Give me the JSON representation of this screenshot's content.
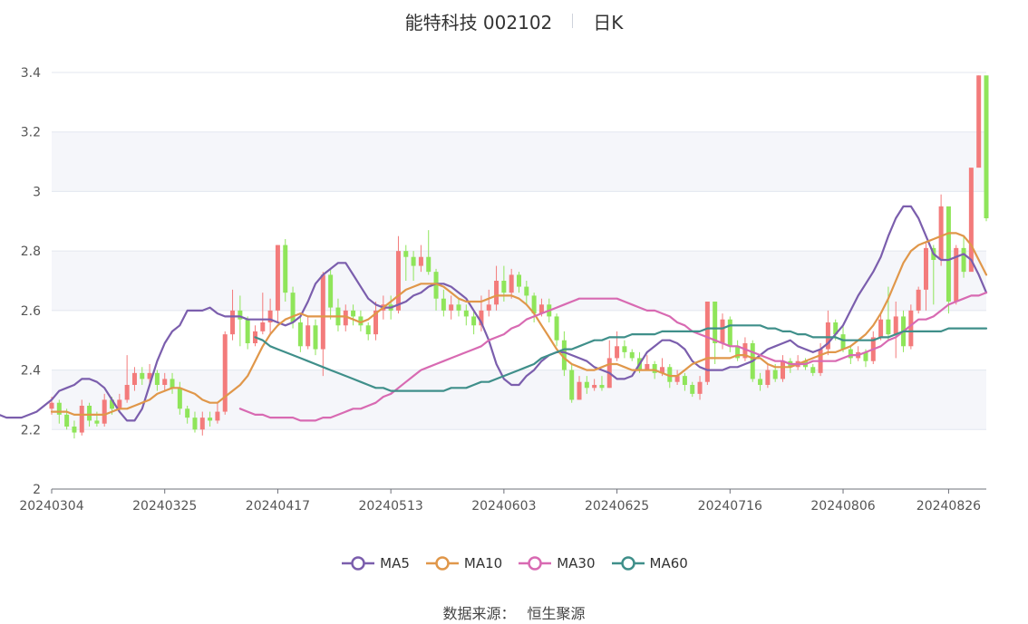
{
  "header": {
    "title": "能特科技 002102",
    "period": "日K"
  },
  "source": {
    "label": "数据来源：",
    "value": "恒生聚源"
  },
  "colors": {
    "up": "#f37b7b",
    "down": "#8fe55a",
    "grid": "#e3e7ef",
    "band": "#f5f6fa",
    "MA5": "#7b5ead",
    "MA10": "#e0974a",
    "MA30": "#d86ab2",
    "MA60": "#3f8f8a"
  },
  "chart_data": {
    "type": "candlestick",
    "ylim": [
      2.0,
      3.4
    ],
    "yticks": [
      "2",
      "2.2",
      "2.4",
      "2.6",
      "2.8",
      "3",
      "3.2",
      "3.4"
    ],
    "xtick_labels": [
      "20240304",
      "20240325",
      "20240417",
      "20240513",
      "20240603",
      "20240625",
      "20240716",
      "20240806",
      "20240826"
    ],
    "xtick_index": [
      0,
      15,
      30,
      45,
      60,
      75,
      90,
      105,
      119
    ],
    "candles": [
      [
        2.27,
        2.29,
        2.31,
        2.25
      ],
      [
        2.29,
        2.25,
        2.3,
        2.22
      ],
      [
        2.25,
        2.21,
        2.27,
        2.2
      ],
      [
        2.21,
        2.19,
        2.23,
        2.17
      ],
      [
        2.19,
        2.28,
        2.3,
        2.18
      ],
      [
        2.28,
        2.23,
        2.29,
        2.21
      ],
      [
        2.23,
        2.22,
        2.26,
        2.21
      ],
      [
        2.22,
        2.3,
        2.32,
        2.21
      ],
      [
        2.3,
        2.27,
        2.31,
        2.25
      ],
      [
        2.27,
        2.3,
        2.32,
        2.26
      ],
      [
        2.3,
        2.35,
        2.45,
        2.29
      ],
      [
        2.35,
        2.39,
        2.41,
        2.33
      ],
      [
        2.39,
        2.37,
        2.41,
        2.35
      ],
      [
        2.37,
        2.39,
        2.42,
        2.35
      ],
      [
        2.39,
        2.35,
        2.4,
        2.33
      ],
      [
        2.35,
        2.37,
        2.39,
        2.33
      ],
      [
        2.37,
        2.34,
        2.39,
        2.32
      ],
      [
        2.34,
        2.27,
        2.36,
        2.25
      ],
      [
        2.27,
        2.24,
        2.28,
        2.22
      ],
      [
        2.24,
        2.2,
        2.26,
        2.19
      ],
      [
        2.2,
        2.24,
        2.26,
        2.18
      ],
      [
        2.24,
        2.23,
        2.26,
        2.21
      ],
      [
        2.23,
        2.26,
        2.29,
        2.22
      ],
      [
        2.26,
        2.52,
        2.53,
        2.25
      ],
      [
        2.52,
        2.6,
        2.67,
        2.5
      ],
      [
        2.6,
        2.57,
        2.65,
        2.48
      ],
      [
        2.57,
        2.49,
        2.58,
        2.47
      ],
      [
        2.49,
        2.53,
        2.55,
        2.48
      ],
      [
        2.53,
        2.56,
        2.66,
        2.52
      ],
      [
        2.56,
        2.6,
        2.64,
        2.52
      ],
      [
        2.6,
        2.82,
        2.82,
        2.56
      ],
      [
        2.82,
        2.66,
        2.84,
        2.63
      ],
      [
        2.66,
        2.56,
        2.68,
        2.54
      ],
      [
        2.56,
        2.48,
        2.58,
        2.46
      ],
      [
        2.48,
        2.55,
        2.58,
        2.47
      ],
      [
        2.55,
        2.47,
        2.57,
        2.45
      ],
      [
        2.47,
        2.72,
        2.73,
        2.38
      ],
      [
        2.72,
        2.61,
        2.74,
        2.57
      ],
      [
        2.61,
        2.55,
        2.64,
        2.53
      ],
      [
        2.55,
        2.6,
        2.62,
        2.53
      ],
      [
        2.6,
        2.58,
        2.62,
        2.55
      ],
      [
        2.58,
        2.55,
        2.6,
        2.53
      ],
      [
        2.55,
        2.52,
        2.56,
        2.5
      ],
      [
        2.52,
        2.6,
        2.63,
        2.5
      ],
      [
        2.6,
        2.62,
        2.65,
        2.57
      ],
      [
        2.62,
        2.6,
        2.65,
        2.57
      ],
      [
        2.6,
        2.8,
        2.85,
        2.59
      ],
      [
        2.8,
        2.78,
        2.82,
        2.7
      ],
      [
        2.78,
        2.75,
        2.8,
        2.7
      ],
      [
        2.75,
        2.78,
        2.82,
        2.73
      ],
      [
        2.78,
        2.73,
        2.87,
        2.72
      ],
      [
        2.73,
        2.64,
        2.74,
        2.6
      ],
      [
        2.64,
        2.6,
        2.67,
        2.58
      ],
      [
        2.6,
        2.62,
        2.65,
        2.57
      ],
      [
        2.62,
        2.6,
        2.64,
        2.58
      ],
      [
        2.6,
        2.58,
        2.62,
        2.55
      ],
      [
        2.58,
        2.55,
        2.6,
        2.52
      ],
      [
        2.55,
        2.6,
        2.65,
        2.53
      ],
      [
        2.6,
        2.62,
        2.67,
        2.58
      ],
      [
        2.62,
        2.7,
        2.75,
        2.6
      ],
      [
        2.7,
        2.66,
        2.75,
        2.63
      ],
      [
        2.66,
        2.72,
        2.74,
        2.64
      ],
      [
        2.72,
        2.68,
        2.73,
        2.66
      ],
      [
        2.68,
        2.65,
        2.7,
        2.62
      ],
      [
        2.65,
        2.59,
        2.66,
        2.56
      ],
      [
        2.59,
        2.62,
        2.64,
        2.58
      ],
      [
        2.62,
        2.58,
        2.64,
        2.56
      ],
      [
        2.58,
        2.5,
        2.59,
        2.48
      ],
      [
        2.5,
        2.4,
        2.53,
        2.38
      ],
      [
        2.4,
        2.3,
        2.42,
        2.29
      ],
      [
        2.3,
        2.36,
        2.38,
        2.3
      ],
      [
        2.36,
        2.34,
        2.38,
        2.32
      ],
      [
        2.34,
        2.35,
        2.37,
        2.33
      ],
      [
        2.35,
        2.34,
        2.38,
        2.33
      ],
      [
        2.34,
        2.44,
        2.5,
        2.34
      ],
      [
        2.44,
        2.48,
        2.53,
        2.43
      ],
      [
        2.48,
        2.46,
        2.5,
        2.44
      ],
      [
        2.46,
        2.44,
        2.47,
        2.43
      ],
      [
        2.44,
        2.4,
        2.46,
        2.39
      ],
      [
        2.4,
        2.42,
        2.45,
        2.4
      ],
      [
        2.42,
        2.39,
        2.43,
        2.37
      ],
      [
        2.39,
        2.41,
        2.44,
        2.38
      ],
      [
        2.41,
        2.36,
        2.42,
        2.34
      ],
      [
        2.36,
        2.38,
        2.4,
        2.35
      ],
      [
        2.38,
        2.35,
        2.39,
        2.33
      ],
      [
        2.35,
        2.32,
        2.36,
        2.31
      ],
      [
        2.32,
        2.36,
        2.38,
        2.3
      ],
      [
        2.36,
        2.63,
        2.63,
        2.35
      ],
      [
        2.63,
        2.49,
        2.63,
        2.42
      ],
      [
        2.49,
        2.57,
        2.59,
        2.47
      ],
      [
        2.57,
        2.48,
        2.58,
        2.46
      ],
      [
        2.48,
        2.44,
        2.5,
        2.43
      ],
      [
        2.44,
        2.49,
        2.51,
        2.43
      ],
      [
        2.49,
        2.37,
        2.5,
        2.36
      ],
      [
        2.37,
        2.35,
        2.39,
        2.33
      ],
      [
        2.35,
        2.4,
        2.42,
        2.34
      ],
      [
        2.4,
        2.37,
        2.42,
        2.36
      ],
      [
        2.37,
        2.43,
        2.45,
        2.36
      ],
      [
        2.43,
        2.41,
        2.44,
        2.39
      ],
      [
        2.41,
        2.43,
        2.45,
        2.4
      ],
      [
        2.43,
        2.41,
        2.44,
        2.4
      ],
      [
        2.41,
        2.39,
        2.42,
        2.38
      ],
      [
        2.39,
        2.47,
        2.49,
        2.38
      ],
      [
        2.47,
        2.56,
        2.6,
        2.45
      ],
      [
        2.56,
        2.52,
        2.57,
        2.5
      ],
      [
        2.52,
        2.47,
        2.55,
        2.46
      ],
      [
        2.47,
        2.44,
        2.48,
        2.42
      ],
      [
        2.44,
        2.46,
        2.48,
        2.43
      ],
      [
        2.46,
        2.43,
        2.47,
        2.41
      ],
      [
        2.43,
        2.51,
        2.53,
        2.42
      ],
      [
        2.51,
        2.57,
        2.59,
        2.5
      ],
      [
        2.57,
        2.52,
        2.68,
        2.5
      ],
      [
        2.52,
        2.58,
        2.63,
        2.44
      ],
      [
        2.58,
        2.48,
        2.6,
        2.46
      ],
      [
        2.48,
        2.6,
        2.62,
        2.47
      ],
      [
        2.6,
        2.67,
        2.68,
        2.59
      ],
      [
        2.67,
        2.81,
        2.83,
        2.6
      ],
      [
        2.81,
        2.77,
        2.82,
        2.62
      ],
      [
        2.77,
        2.95,
        2.99,
        2.75
      ],
      [
        2.95,
        2.63,
        2.65,
        2.59
      ],
      [
        2.63,
        2.81,
        2.82,
        2.62
      ],
      [
        2.81,
        2.73,
        2.85,
        2.71
      ],
      [
        2.73,
        3.08,
        3.08,
        3.08
      ],
      [
        3.08,
        3.39,
        3.39,
        3.22
      ],
      [
        3.39,
        2.91,
        3.26,
        2.9
      ]
    ],
    "series": [
      {
        "name": "MA5",
        "values": [
          2.26,
          2.25,
          2.25,
          2.24,
          2.24,
          2.24,
          2.25,
          2.26,
          2.28,
          2.3,
          2.33,
          2.34,
          2.35,
          2.37,
          2.37,
          2.36,
          2.34,
          2.3,
          2.26,
          2.23,
          2.23,
          2.27,
          2.35,
          2.43,
          2.49,
          2.53,
          2.55,
          2.6,
          2.6,
          2.6,
          2.61,
          2.59,
          2.58,
          2.58,
          2.58,
          2.57,
          2.57,
          2.57,
          2.57,
          2.56,
          2.55,
          2.56,
          2.58,
          2.63,
          2.69,
          2.72,
          2.74,
          2.76,
          2.76,
          2.72,
          2.68,
          2.64,
          2.62,
          2.61,
          2.61,
          2.62,
          2.63,
          2.65,
          2.66,
          2.68,
          2.69,
          2.69,
          2.68,
          2.66,
          2.64,
          2.6,
          2.56,
          2.5,
          2.42,
          2.37,
          2.35,
          2.35,
          2.38,
          2.4,
          2.43,
          2.45,
          2.46,
          2.46,
          2.45,
          2.44,
          2.43,
          2.41,
          2.4,
          2.39,
          2.37,
          2.37,
          2.38,
          2.42,
          2.46,
          2.48,
          2.5,
          2.5,
          2.49,
          2.47,
          2.43,
          2.41,
          2.4,
          2.4,
          2.4,
          2.41,
          2.41,
          2.42,
          2.43,
          2.45,
          2.47,
          2.48,
          2.49,
          2.5,
          2.48,
          2.47,
          2.46,
          2.47,
          2.49,
          2.52,
          2.55,
          2.6,
          2.65,
          2.69,
          2.73,
          2.78,
          2.85,
          2.91,
          2.95,
          2.95,
          2.91,
          2.85,
          2.79,
          2.77,
          2.77,
          2.78,
          2.79,
          2.77,
          2.72,
          2.66
        ]
      },
      {
        "name": "MA10",
        "values": [
          2.26,
          2.26,
          2.26,
          2.25,
          2.25,
          2.25,
          2.25,
          2.25,
          2.26,
          2.27,
          2.27,
          2.28,
          2.29,
          2.3,
          2.32,
          2.33,
          2.34,
          2.34,
          2.33,
          2.32,
          2.3,
          2.29,
          2.29,
          2.31,
          2.33,
          2.35,
          2.38,
          2.43,
          2.48,
          2.52,
          2.55,
          2.57,
          2.58,
          2.59,
          2.58,
          2.58,
          2.58,
          2.58,
          2.58,
          2.58,
          2.57,
          2.56,
          2.57,
          2.59,
          2.61,
          2.63,
          2.65,
          2.67,
          2.68,
          2.69,
          2.69,
          2.69,
          2.68,
          2.66,
          2.64,
          2.63,
          2.63,
          2.63,
          2.64,
          2.65,
          2.65,
          2.65,
          2.64,
          2.62,
          2.59,
          2.55,
          2.51,
          2.47,
          2.44,
          2.42,
          2.41,
          2.4,
          2.4,
          2.41,
          2.42,
          2.42,
          2.41,
          2.4,
          2.4,
          2.4,
          2.4,
          2.39,
          2.38,
          2.38,
          2.4,
          2.42,
          2.43,
          2.44,
          2.44,
          2.44,
          2.44,
          2.45,
          2.45,
          2.44,
          2.44,
          2.42,
          2.41,
          2.41,
          2.41,
          2.42,
          2.43,
          2.44,
          2.45,
          2.46,
          2.46,
          2.47,
          2.48,
          2.5,
          2.52,
          2.55,
          2.59,
          2.64,
          2.7,
          2.76,
          2.8,
          2.82,
          2.83,
          2.84,
          2.85,
          2.86,
          2.86,
          2.85,
          2.82,
          2.77,
          2.72
        ]
      },
      {
        "name": "MA30",
        "values": [
          2.27,
          2.26,
          2.25,
          2.25,
          2.24,
          2.24,
          2.24,
          2.24,
          2.23,
          2.23,
          2.23,
          2.24,
          2.24,
          2.25,
          2.26,
          2.27,
          2.27,
          2.28,
          2.29,
          2.31,
          2.32,
          2.34,
          2.36,
          2.38,
          2.4,
          2.41,
          2.42,
          2.43,
          2.44,
          2.45,
          2.46,
          2.47,
          2.48,
          2.5,
          2.51,
          2.52,
          2.54,
          2.55,
          2.57,
          2.58,
          2.59,
          2.6,
          2.61,
          2.62,
          2.63,
          2.64,
          2.64,
          2.64,
          2.64,
          2.64,
          2.64,
          2.63,
          2.62,
          2.61,
          2.6,
          2.6,
          2.59,
          2.58,
          2.56,
          2.55,
          2.53,
          2.52,
          2.51,
          2.5,
          2.49,
          2.48,
          2.48,
          2.47,
          2.46,
          2.45,
          2.44,
          2.43,
          2.43,
          2.42,
          2.42,
          2.42,
          2.43,
          2.43,
          2.43,
          2.43,
          2.44,
          2.45,
          2.45,
          2.46,
          2.47,
          2.48,
          2.5,
          2.51,
          2.53,
          2.55,
          2.57,
          2.57,
          2.58,
          2.6,
          2.62,
          2.63,
          2.64,
          2.65,
          2.65,
          2.66
        ]
      },
      {
        "name": "MA60",
        "values": [
          2.51,
          2.5,
          2.48,
          2.47,
          2.46,
          2.45,
          2.44,
          2.43,
          2.42,
          2.41,
          2.4,
          2.39,
          2.38,
          2.37,
          2.36,
          2.35,
          2.34,
          2.34,
          2.33,
          2.33,
          2.33,
          2.33,
          2.33,
          2.33,
          2.33,
          2.33,
          2.34,
          2.34,
          2.34,
          2.35,
          2.36,
          2.36,
          2.37,
          2.38,
          2.39,
          2.4,
          2.41,
          2.42,
          2.44,
          2.45,
          2.46,
          2.47,
          2.47,
          2.48,
          2.49,
          2.5,
          2.5,
          2.51,
          2.51,
          2.51,
          2.52,
          2.52,
          2.52,
          2.52,
          2.53,
          2.53,
          2.53,
          2.53,
          2.53,
          2.53,
          2.54,
          2.54,
          2.54,
          2.55,
          2.55,
          2.55,
          2.55,
          2.55,
          2.54,
          2.54,
          2.53,
          2.53,
          2.52,
          2.52,
          2.51,
          2.51,
          2.51,
          2.51,
          2.5,
          2.5,
          2.5,
          2.5,
          2.5,
          2.51,
          2.51,
          2.52,
          2.53,
          2.53,
          2.53,
          2.53,
          2.53,
          2.53,
          2.54,
          2.54,
          2.54,
          2.54,
          2.54,
          2.54
        ]
      }
    ],
    "legend": [
      "MA5",
      "MA10",
      "MA30",
      "MA60"
    ]
  }
}
